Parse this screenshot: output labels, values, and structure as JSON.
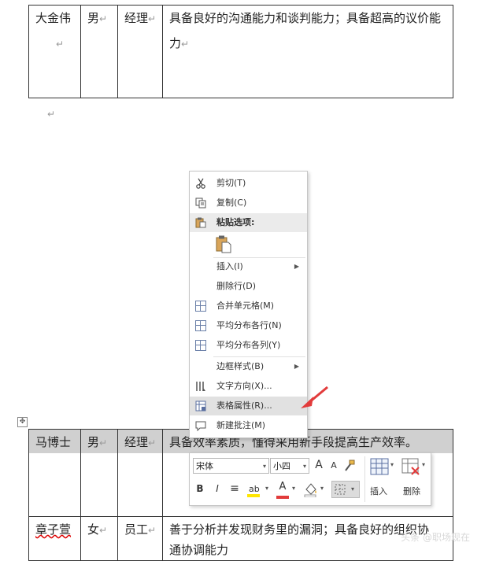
{
  "top_table": {
    "row": {
      "name": "大金伟",
      "gender": "男",
      "title": "经理",
      "desc": "具备良好的沟通能力和谈判能力；具备超高的议价能力"
    }
  },
  "bottom_table": {
    "rows": [
      {
        "name": "马博士",
        "gender": "男",
        "title": "经理",
        "desc": "具备效率素质，懂得采用新手段提高生产效率。"
      },
      {
        "name": "章子萱",
        "gender": "女",
        "title": "员工",
        "desc": "善于分析并发现财务里的漏洞；具备良好的组织协",
        "desc2": "通协调能力"
      }
    ]
  },
  "marks": {
    "para": "↵",
    "para_cell": "↵",
    "move": "✥"
  },
  "context_menu": {
    "cut": "剪切(T)",
    "copy": "复制(C)",
    "paste_options": "粘贴选项:",
    "insert": "插入(I)",
    "delete_row": "删除行(D)",
    "merge_cells": "合并单元格(M)",
    "distribute_rows": "平均分布各行(N)",
    "distribute_cols": "平均分布各列(Y)",
    "border_styles": "边框样式(B)",
    "text_direction": "文字方向(X)...",
    "table_properties": "表格属性(R)...",
    "new_comment": "新建批注(M)",
    "submenu_arrow": "▶"
  },
  "mini_toolbar": {
    "font": "宋体",
    "size": "小四",
    "grow": "A",
    "shrink": "A",
    "bold": "B",
    "italic": "I",
    "align": "≡",
    "font_color_letter": "A",
    "insert": "插入",
    "delete": "删除",
    "dropdown": "▾"
  },
  "colors": {
    "accent_red": "#e23b3b",
    "highlight": "#e1e1e1",
    "yellow": "#ffe600"
  },
  "watermark": "头条 @职场现在"
}
